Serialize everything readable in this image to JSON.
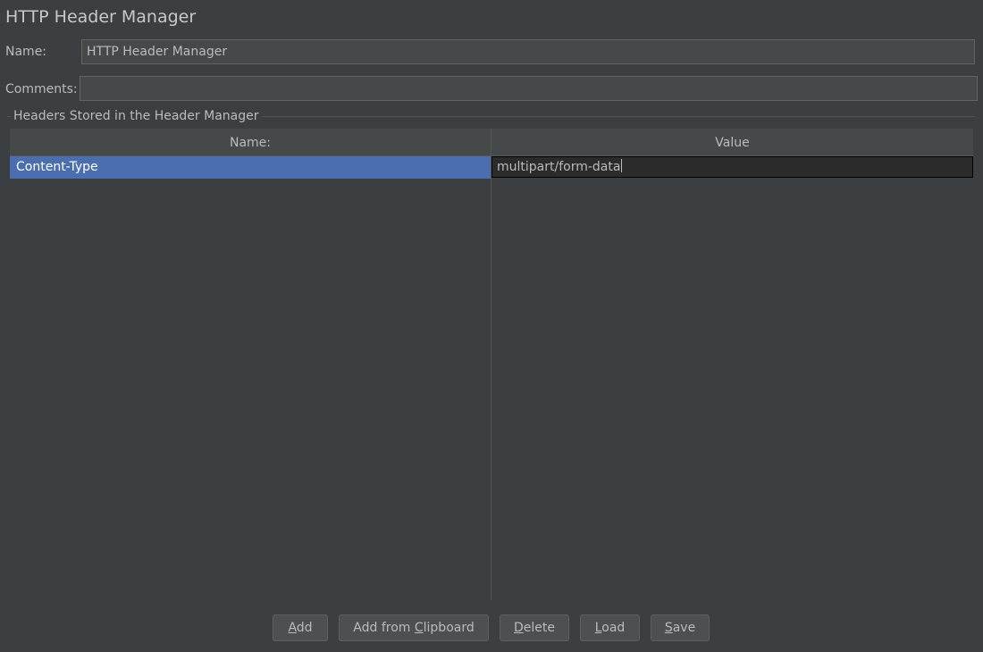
{
  "panel": {
    "title": "HTTP Header Manager"
  },
  "form": {
    "name_label": "Name:",
    "name_value": "HTTP Header Manager",
    "comments_label": "Comments:",
    "comments_value": ""
  },
  "headers_group": {
    "title": "Headers Stored in the Header Manager",
    "columns": [
      "Name:",
      "Value"
    ],
    "rows": [
      {
        "name": "Content-Type",
        "value": "multipart/form-data",
        "selected": true,
        "editing": "value"
      }
    ]
  },
  "buttons": [
    {
      "label": "Add",
      "mnemonic": "A"
    },
    {
      "label": "Add from Clipboard",
      "mnemonic": "C"
    },
    {
      "label": "Delete",
      "mnemonic": "D"
    },
    {
      "label": "Load",
      "mnemonic": "L"
    },
    {
      "label": "Save",
      "mnemonic": "S"
    }
  ],
  "colors": {
    "background": "#3c3f41",
    "selection": "#4b6eaf",
    "field": "#45494a",
    "editor": "#2b2b2b"
  }
}
